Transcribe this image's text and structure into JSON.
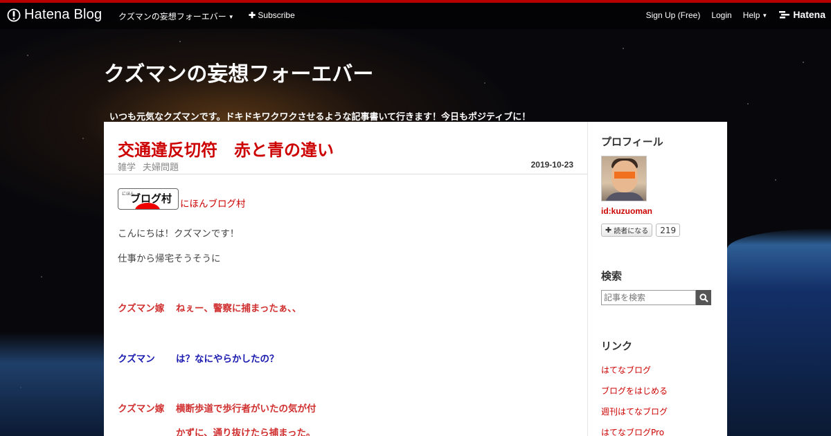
{
  "topbar": {
    "logo_text": "Hatena Blog",
    "blog_menu": "クズマンの妄想フォーエバー",
    "subscribe": "Subscribe",
    "signup": "Sign Up (Free)",
    "login": "Login",
    "help": "Help",
    "brand": "Hatena"
  },
  "header": {
    "title": "クズマンの妄想フォーエバー",
    "description": "いつも元気なクズマンです。ドキドキワクワクさせるような記事書いて行きます！今日もポジティブに！"
  },
  "entry": {
    "title": "交通違反切符　赤と青の違い",
    "categories": [
      "雑学",
      "夫婦問題"
    ],
    "date": "2019-10-23",
    "banner_small": "にほん",
    "banner_big": "ブログ村",
    "banner_link": "にほんブログ村",
    "para1": "こんにちは！クズマンです！",
    "para2": "仕事から帰宅そうそうに",
    "dialog": [
      {
        "speaker": "クズマン嫁",
        "text": "ねぇー、警察に捕まったぁ、、"
      },
      {
        "speaker": "クズマン",
        "text": "は？なにやらかしたの？"
      },
      {
        "speaker": "クズマン嫁",
        "text": "横断歩道で歩行者がいたの気が付"
      },
      {
        "speaker": "",
        "text": "かずに、通り抜けたら捕まった。"
      }
    ]
  },
  "sidebar": {
    "profile_heading": "プロフィール",
    "user_id": "id:kuzuoman",
    "follow_label": "読者になる",
    "follow_count": "219",
    "search_heading": "検索",
    "search_placeholder": "記事を検索",
    "links_heading": "リンク",
    "links": [
      "はてなブログ",
      "ブログをはじめる",
      "週刊はてなブログ",
      "はてなブログPro"
    ]
  },
  "colors": {
    "accent": "#cc0000",
    "topbar_border": "#b70000",
    "dialog_blue": "#1a1ab0"
  }
}
